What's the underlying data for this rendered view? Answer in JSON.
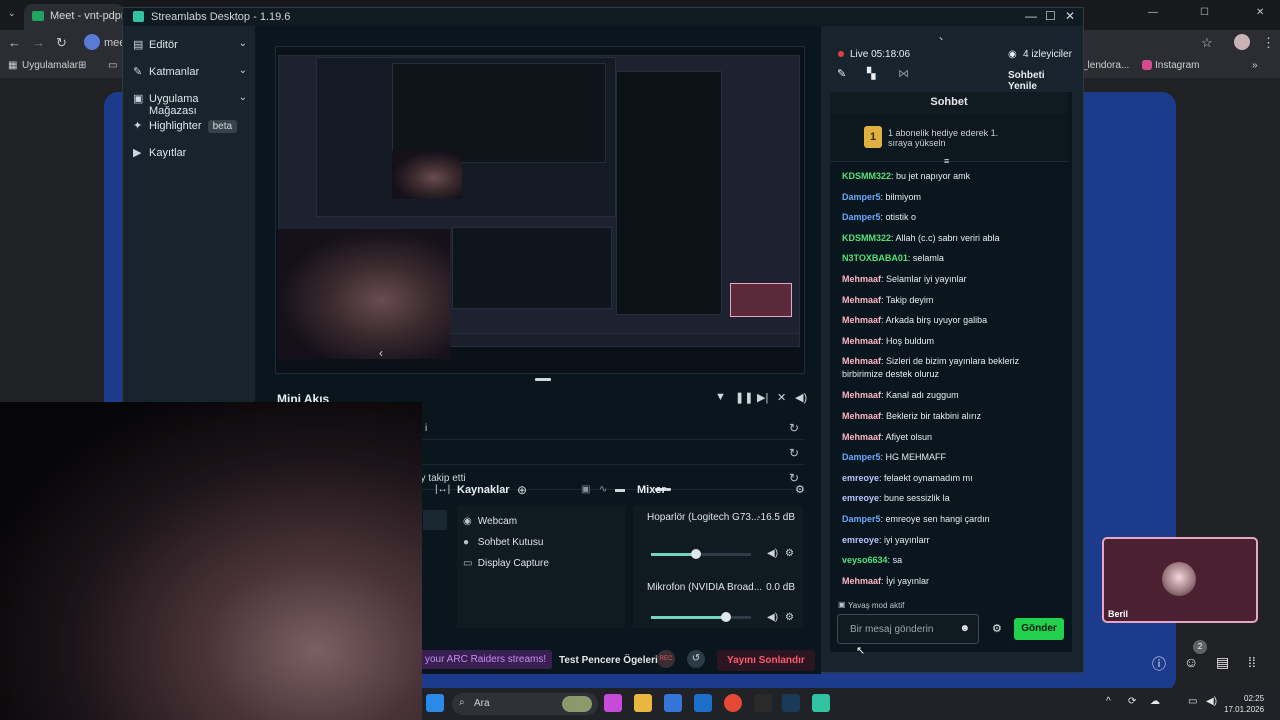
{
  "browser": {
    "tab_title": "Meet - vnt-pdpn-co",
    "omnibox_text": "mee",
    "bookmarks": [
      "Uygulamalar",
      "_lendora...",
      "Instagram"
    ]
  },
  "streamlabs": {
    "title": "Streamlabs Desktop - 1.19.6",
    "sidebar": {
      "items": [
        {
          "label": "Editör",
          "icon": "editor-icon",
          "chevron": true
        },
        {
          "label": "Katmanlar",
          "icon": "layers-icon",
          "chevron": true
        },
        {
          "label": "Uygulama Mağazası",
          "icon": "store-icon",
          "chevron": true
        },
        {
          "label": "Highlighter",
          "icon": "highlighter-icon",
          "badge": "beta"
        },
        {
          "label": "Kayıtlar",
          "icon": "recordings-icon"
        }
      ]
    },
    "mini_flow": {
      "title": "Mini Akış",
      "rows": [
        "i",
        "",
        "ny takip etti"
      ],
      "row_suffix": "takip etti"
    },
    "sources": {
      "title": "Kaynaklar",
      "items": [
        {
          "label": "Webcam",
          "icon": "webcam-icon"
        },
        {
          "label": "Sohbet Kutusu",
          "icon": "chat-box-icon"
        },
        {
          "label": "Display Capture",
          "icon": "monitor-icon"
        }
      ]
    },
    "mixer": {
      "title": "Mixer",
      "channels": [
        {
          "label": "Hoparlör (Logitech G73...",
          "db": "-16.5 dB",
          "level": 0.45
        },
        {
          "label": "Mikrofon (NVIDIA Broad...",
          "db": "0.0 dB",
          "level": 0.75
        }
      ]
    },
    "footer": {
      "arc_button": "your ARC Raiders streams!",
      "test_label": "Test Pencere Ögeleri",
      "rec_label": "REC",
      "end_button": "Yayını Sonlandır"
    },
    "live": {
      "status": "Live 05:18:06",
      "viewers": "4 izleyiciler",
      "refresh_chat": "Sohbeti Yenile"
    },
    "chat": {
      "title": "Sohbet",
      "gift_banner": "1 abonelik hediye ederek 1. sıraya yükseln",
      "gift_rank": "1",
      "messages": [
        {
          "user": "KDSMM322",
          "text": "bu jet napıyor amk",
          "color": "#55e07a"
        },
        {
          "user": "Damper5",
          "text": "bilmiyom",
          "color": "#6aa8ff"
        },
        {
          "user": "Damper5",
          "text": "otistik o",
          "color": "#6aa8ff"
        },
        {
          "user": "KDSMM322",
          "text": "Allah (c.c) sabrı veriri abla",
          "color": "#55e07a"
        },
        {
          "user": "N3TOXBABA01",
          "text": "selamla",
          "color": "#55e07a"
        },
        {
          "user": "Mehmaaf",
          "text": "Selamlar iyi yayınlar",
          "color": "#ffb3c4"
        },
        {
          "user": "Mehmaaf",
          "text": "Takip deyim",
          "color": "#ffb3c4"
        },
        {
          "user": "Mehmaaf",
          "text": "Arkada birş uyuyor galiba",
          "color": "#ffb3c4"
        },
        {
          "user": "Mehmaaf",
          "text": "Hoş buldum",
          "color": "#ffb3c4"
        },
        {
          "user": "Mehmaaf",
          "text": "Sizleri de bizim yayınlara bekleriz birbirimize destek oluruz",
          "color": "#ffb3c4"
        },
        {
          "user": "Mehmaaf",
          "text": "Kanal adı zuggum",
          "color": "#ffb3c4"
        },
        {
          "user": "Mehmaaf",
          "text": "Bekleriz bir takbini alırız",
          "color": "#ffb3c4"
        },
        {
          "user": "Mehmaaf",
          "text": "Afiyet olsun",
          "color": "#ffb3c4"
        },
        {
          "user": "Damper5",
          "text": "HG MEHMAFF",
          "color": "#6aa8ff"
        },
        {
          "user": "emreoye",
          "text": "felaekt oynamadım mı",
          "color": "#b7c3ff"
        },
        {
          "user": "emreoye",
          "text": "bune sessizlik la",
          "color": "#b7c3ff"
        },
        {
          "user": "Damper5",
          "text": "emreoye sen hangi çardın",
          "color": "#6aa8ff"
        },
        {
          "user": "emreoye",
          "text": "iyi yayınlarr",
          "color": "#b7c3ff"
        },
        {
          "user": "veyso6634",
          "text": "sa",
          "color": "#55e07a"
        },
        {
          "user": "Mehmaaf",
          "text": "İyi yayınlar",
          "color": "#ffb3c4"
        }
      ],
      "slow_mode": "Yavaş mod aktif",
      "input_placeholder": "Bir mesaj gönderin",
      "send_button": "Gönder"
    }
  },
  "meet": {
    "participant_name": "Beril",
    "participant_count": "2"
  },
  "taskbar": {
    "search_placeholder": "Ara",
    "time": "02:25",
    "date": "17.01.2026"
  },
  "colors": {
    "accent_green": "#21d14e",
    "end_red": "#ff5a6e",
    "live_red": "#e34040",
    "beril_border": "#e7a6c3"
  }
}
